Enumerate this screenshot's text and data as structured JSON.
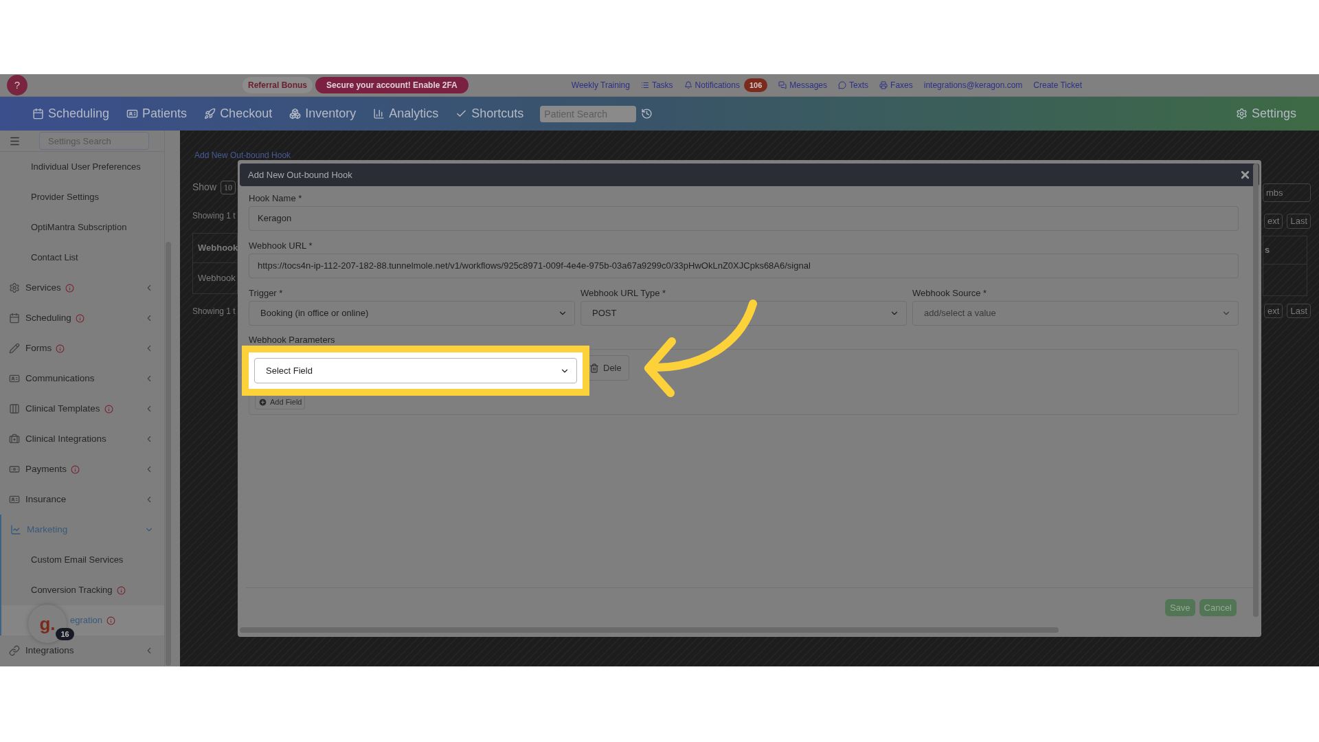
{
  "top_bar": {
    "help": "?",
    "referral": "Referral Bonus",
    "security_alert": "Secure your account! Enable 2FA",
    "links": [
      {
        "label": "Weekly Training"
      },
      {
        "label": "Tasks"
      },
      {
        "label": "Notifications",
        "badge": "106"
      },
      {
        "label": "Messages"
      },
      {
        "label": "Texts"
      },
      {
        "label": "Faxes"
      },
      {
        "label": "integrations@keragon.com"
      },
      {
        "label": "Create Ticket"
      }
    ]
  },
  "nav": {
    "items": [
      {
        "label": "Scheduling"
      },
      {
        "label": "Patients"
      },
      {
        "label": "Checkout"
      },
      {
        "label": "Inventory"
      },
      {
        "label": "Analytics"
      },
      {
        "label": "Shortcuts"
      }
    ],
    "search": {
      "placeholder": "Patient Search"
    },
    "settings": "Settings"
  },
  "sidebar": {
    "search": {
      "placeholder": "Settings Search"
    },
    "items": [
      {
        "kind": "link",
        "label": "Individual User Preferences"
      },
      {
        "kind": "link",
        "label": "Provider Settings"
      },
      {
        "kind": "link",
        "label": "OptiMantra Subscription"
      },
      {
        "kind": "link",
        "label": "Contact List"
      },
      {
        "kind": "section",
        "label": "Services",
        "info": true,
        "expanded": false
      },
      {
        "kind": "section",
        "label": "Scheduling",
        "info": true,
        "expanded": false
      },
      {
        "kind": "section",
        "label": "Forms",
        "info": true,
        "expanded": false
      },
      {
        "kind": "section",
        "label": "Communications",
        "info": false,
        "expanded": false
      },
      {
        "kind": "section",
        "label": "Clinical Templates",
        "info": true,
        "expanded": false
      },
      {
        "kind": "section",
        "label": "Clinical Integrations",
        "info": false,
        "expanded": false
      },
      {
        "kind": "section",
        "label": "Payments",
        "info": true,
        "expanded": false
      },
      {
        "kind": "section",
        "label": "Insurance",
        "info": false,
        "expanded": false
      },
      {
        "kind": "section",
        "label": "Marketing",
        "info": false,
        "expanded": true,
        "children": [
          {
            "label": "Custom Email Services",
            "info": false,
            "selected": false
          },
          {
            "label": "Conversion Tracking",
            "info": true,
            "selected": false
          },
          {
            "label": "egration",
            "info": true,
            "selected": true
          }
        ]
      },
      {
        "kind": "section",
        "label": "Integrations",
        "info": false,
        "expanded": false
      }
    ]
  },
  "chat_widget": {
    "logo": "g.",
    "badge": "16"
  },
  "background_page": {
    "link": "Add New Out-bound Hook",
    "show_label": "Show",
    "page_size": "10",
    "info_top": "Showing 1 t",
    "table_header": "Webhook",
    "table_cell": "Webhook",
    "info_bottom": "Showing 1 t",
    "search_value": "mbs",
    "header_tail": "s",
    "pagers": [
      {
        "next": "ext",
        "last": "Last"
      },
      {
        "next": "ext",
        "last": "Last"
      }
    ]
  },
  "dialog": {
    "title": "Add New Out-bound Hook",
    "fields": [
      {
        "kind": "text",
        "label": "Hook Name *",
        "value": "Keragon"
      },
      {
        "kind": "text",
        "label": "Webhook URL *",
        "value": "https://tocs4n-ip-112-207-182-88.tunnelmole.net/v1/workflows/925c8971-009f-4e4e-975b-03a67a9299c0/33pHwOkLnZ0XJCpks68A6/signal"
      },
      {
        "kind": "select",
        "label": "Trigger *",
        "value": "Booking (in office or online)"
      },
      {
        "kind": "select",
        "label": "Webhook URL Type *",
        "value": "POST"
      },
      {
        "kind": "select",
        "label": "Webhook Source *",
        "placeholder": "add/select a value"
      }
    ],
    "parameters": {
      "label": "Webhook Parameters",
      "rows": [
        {
          "value": "Select Field",
          "highlighted": true,
          "delete": "Dele"
        }
      ],
      "add": "Add Field"
    },
    "buttons": [
      "Save",
      "Cancel"
    ]
  }
}
